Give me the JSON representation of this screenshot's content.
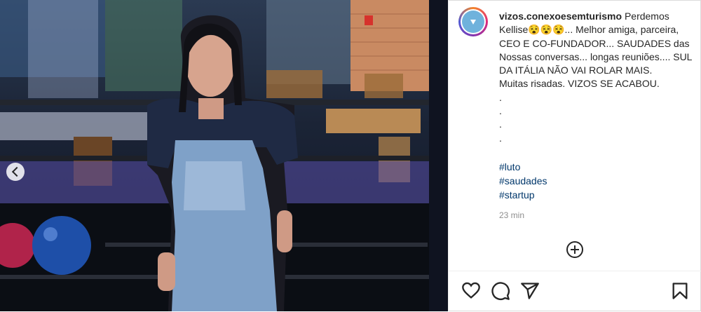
{
  "post": {
    "username": "vizos.conexoesemturismo",
    "caption_text": " Perdemos Kellise😵😵😵... Melhor amiga, parceira, CEO E CO-FUNDADOR... SAUDADES das Nossas conversas... longas reuniões.... SUL DA ITÁLIA NÃO VAI ROLAR MAIS.\nMuitas risadas. VIZOS SE ACABOU.\n.\n.\n.\n.",
    "hashtags": [
      "#luto",
      "#saudades",
      "#startup"
    ],
    "time_ago": "23 min"
  },
  "icons": {
    "prev": "chevron-left-icon",
    "load_more": "plus-circle-icon",
    "like": "heart-icon",
    "comment": "comment-icon",
    "share": "paper-plane-icon",
    "save": "bookmark-icon"
  },
  "colors": {
    "text": "#262626",
    "hashtag": "#00376b",
    "muted": "#8e8e8e",
    "avatar_ring": "#dd2a7b"
  }
}
